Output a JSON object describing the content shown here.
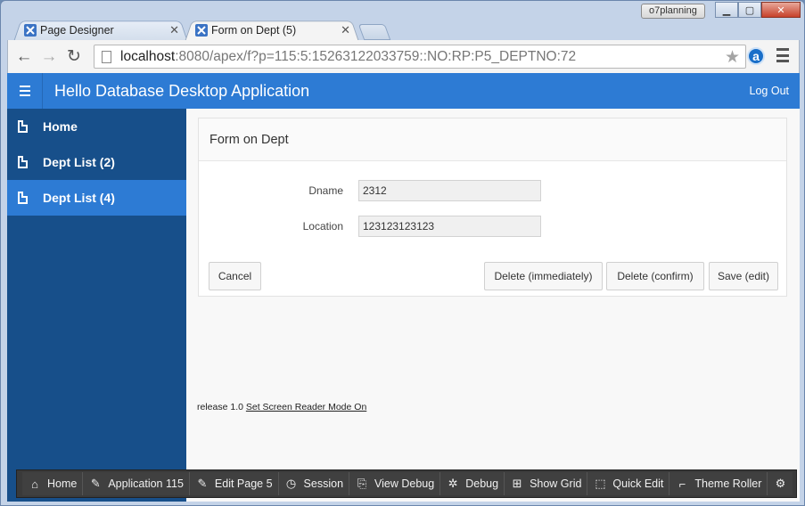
{
  "browser": {
    "tabs": [
      {
        "title": "Page Designer",
        "active": false
      },
      {
        "title": "Form on Dept (5)",
        "active": true
      }
    ],
    "profile_name": "o7planning",
    "url_host": "localhost",
    "url_rest": ":8080/apex/f?p=115:5:15263122033759::NO:RP:P5_DEPTNO:72",
    "extension_glyph": "a"
  },
  "app": {
    "title": "Hello Database Desktop Application",
    "logout_label": "Log Out",
    "nav": [
      {
        "label": "Home",
        "active": false
      },
      {
        "label": "Dept List (2)",
        "active": false
      },
      {
        "label": "Dept List (4)",
        "active": true
      }
    ],
    "form": {
      "title": "Form on Dept",
      "fields": [
        {
          "label": "Dname",
          "value": "2312"
        },
        {
          "label": "Location",
          "value": "123123123123"
        }
      ],
      "buttons": {
        "cancel": "Cancel",
        "delete_immediately": "Delete (immediately)",
        "delete_confirm": "Delete (confirm)",
        "save_edit": "Save (edit)"
      }
    },
    "footer": {
      "release": "release 1.0",
      "screen_reader_link": "Set Screen Reader Mode On"
    }
  },
  "dev_toolbar": {
    "items": [
      {
        "label": "Home",
        "icon": "home-icon"
      },
      {
        "label": "Application 115",
        "icon": "edit-icon"
      },
      {
        "label": "Edit Page 5",
        "icon": "edit-icon"
      },
      {
        "label": "Session",
        "icon": "clock-icon"
      },
      {
        "label": "View Debug",
        "icon": "view-debug-icon"
      },
      {
        "label": "Debug",
        "icon": "bug-icon"
      },
      {
        "label": "Show Grid",
        "icon": "grid-icon"
      },
      {
        "label": "Quick Edit",
        "icon": "cursor-icon"
      },
      {
        "label": "Theme Roller",
        "icon": "paint-roller-icon"
      }
    ],
    "settings_icon": "gear-icon"
  }
}
